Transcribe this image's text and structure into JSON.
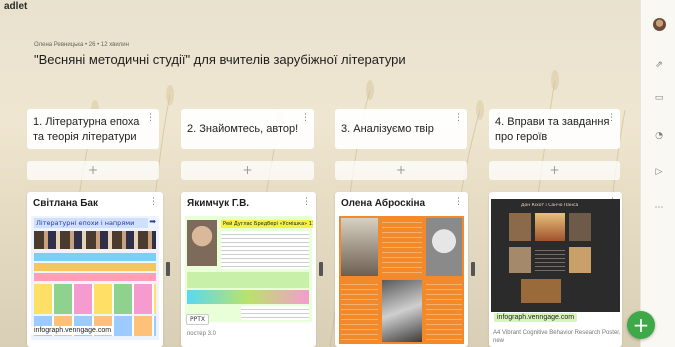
{
  "brand": "adlet",
  "byline": "Олена Ревницька • 26 • 12 хвилин",
  "title": "\"Весняні методичні студії\" для вчителів зарубіжної літератури",
  "columns": [
    {
      "title": "1. Літературна епоха та теорія літератури"
    },
    {
      "title": "2. Знайомтесь, автор!"
    },
    {
      "title": "3. Аналізуємо твір"
    },
    {
      "title": "4. Вправи та завдання про героїв"
    }
  ],
  "add_label": "+",
  "cards": {
    "c1": {
      "name": "Світлана Бак",
      "thumb_title": "Літературні епохи і напрями",
      "link": "infograph.venngage.com"
    },
    "c2": {
      "name": "Якимчук Г.В.",
      "thumb_title": "Рей Дуглас Бредбері «Усмішка» 11/03",
      "chip": "PPTX",
      "caption": "постер 3.0"
    },
    "c3": {
      "name": "Олена Аброскіна"
    },
    "c4": {
      "link": "infograph.venngage.com",
      "caption": "A4 Vibrant Cognitive Behavior Research Poster, new",
      "thumb_title": "Дон Кіхот і Санчо Панса"
    }
  },
  "fab_label": "+",
  "icons": [
    "avatar",
    "share-icon",
    "sections-icon",
    "bell-icon",
    "play-icon",
    "more-icon"
  ],
  "colors": {
    "fab": "#3fa848",
    "poster_green": "#c8f0a9",
    "poster_orange": "#f28a2b"
  }
}
